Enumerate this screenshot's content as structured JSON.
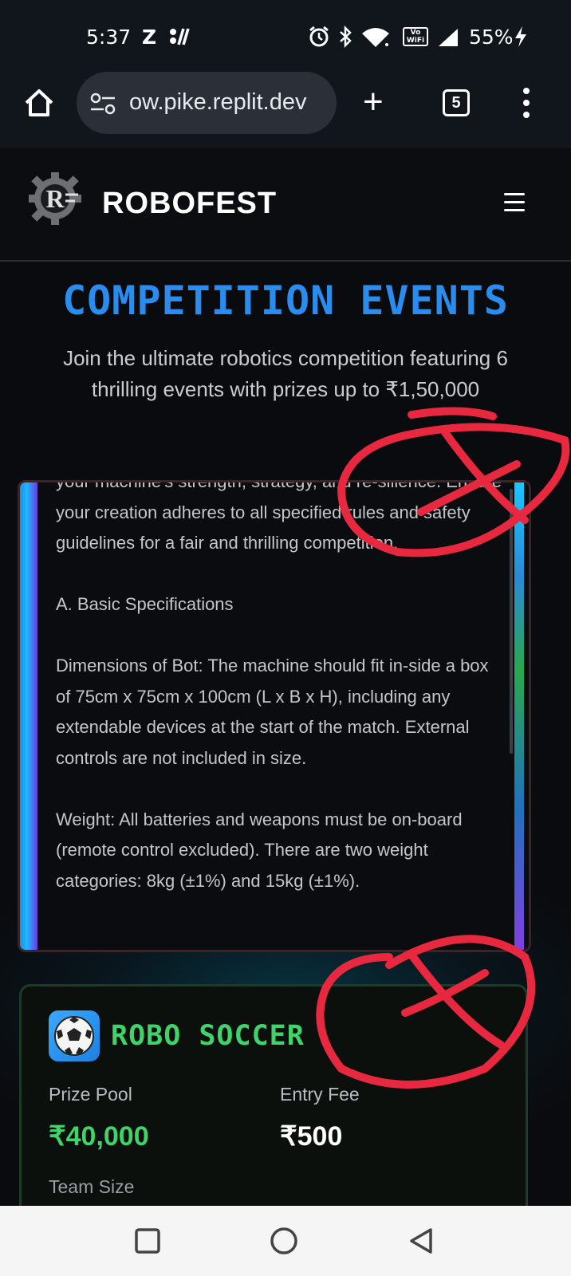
{
  "status_bar": {
    "time": "5:37",
    "carrier": "Z",
    "vowifi": "Vo WiFi",
    "battery": "55%"
  },
  "browser": {
    "url": "ow.pike.replit.dev",
    "tab_count": "5",
    "new_tab": "+"
  },
  "site": {
    "brand": "ROBOFEST",
    "logo_letter": "R"
  },
  "hero": {
    "title": "COMPETITION EVENTS",
    "subtitle": "Join the ultimate robotics competition featuring 6 thrilling events with prizes up to ₹1,50,000"
  },
  "rules": {
    "paragraphs": [
      "your machine's strength, strategy, and re-silience. Ensure your creation adheres to all specified rules and safety guidelines for a fair and thrilling competition.",
      "A. Basic Specifications",
      "Dimensions of Bot: The machine should fit in-side a box of 75cm x 75cm x 100cm (L x B x H), including any extendable devices at the start of the match. External controls are not included in size.",
      "Weight: All batteries and weapons must be on-board (remote control excluded). There are two weight categories: 8kg (±1%) and 15kg (±1%)."
    ]
  },
  "event": {
    "name": "ROBO SOCCER",
    "icon": "soccer-ball-icon",
    "prize_label": "Prize Pool",
    "prize_value": "₹40,000",
    "fee_label": "Entry Fee",
    "fee_value": "₹500",
    "team_label": "Team Size"
  },
  "colors": {
    "accent_blue": "#2b8cf0",
    "accent_green": "#3fd36a",
    "annotation_red": "#e8283f"
  }
}
